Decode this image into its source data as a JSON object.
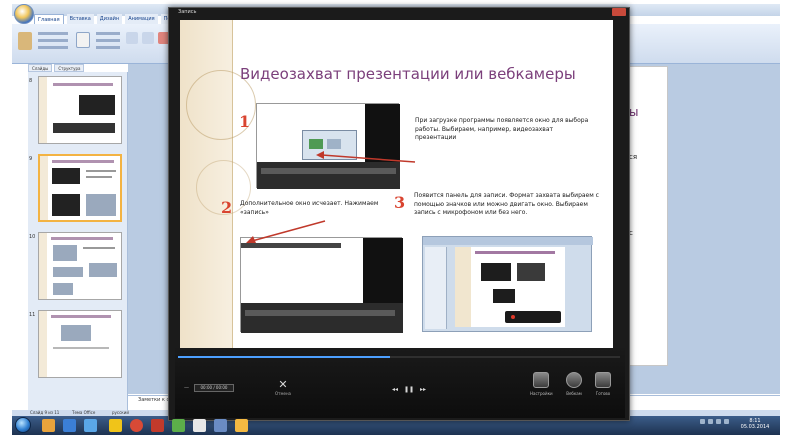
{
  "recorder": {
    "window_title": "Запись",
    "time": "00:00 / 00:00",
    "time_prefix": "—",
    "cancel_label": "Отмена",
    "playback": {
      "rewind": "◂◂",
      "pause": "❚❚",
      "forward": "▸▸"
    },
    "buttons": [
      {
        "label": "Настройки"
      },
      {
        "label": "Вебкам"
      },
      {
        "label": "Готово"
      }
    ],
    "progress": 0.48
  },
  "slide": {
    "title": "Видеозахват презентации или вебкамеры",
    "steps": [
      {
        "num": "1",
        "text": "При загрузке программы появляется окно для выбора работы. Выбираем, например, видеозахват презентации"
      },
      {
        "num": "2",
        "text": "Дополнительное окно исчезает. Нажимаем «запись»"
      },
      {
        "num": "3",
        "text": "Появится панель для записи. Формат захвата выбираем с помощью значков или можно двигать окно. Выбираем запись с микрофоном или без него."
      }
    ]
  },
  "powerpoint": {
    "tabs": [
      "Главная",
      "Вставка",
      "Дизайн",
      "Анимация",
      "Показ"
    ],
    "outline_tabs": [
      "Слайды",
      "Структура"
    ],
    "thumb_numbers": [
      "8",
      "9",
      "10",
      "11"
    ],
    "notes_text": "Заметки к слайду",
    "status": [
      "Слайд 9 из 11",
      "Тема Office",
      "русский"
    ],
    "right_slide_fragments": [
      "ы",
      "ся",
      "с"
    ]
  },
  "taskbar": {
    "clock_time": "8:11",
    "clock_date": "05.03.2014",
    "icon_colors": [
      "#e8a33c",
      "#3b7fd6",
      "#5aa7e8",
      "#f0c419",
      "#d84a36",
      "#c23a2b",
      "#5cae4a",
      "#e8e8e8",
      "#6a8cc4",
      "#f4b942"
    ]
  }
}
